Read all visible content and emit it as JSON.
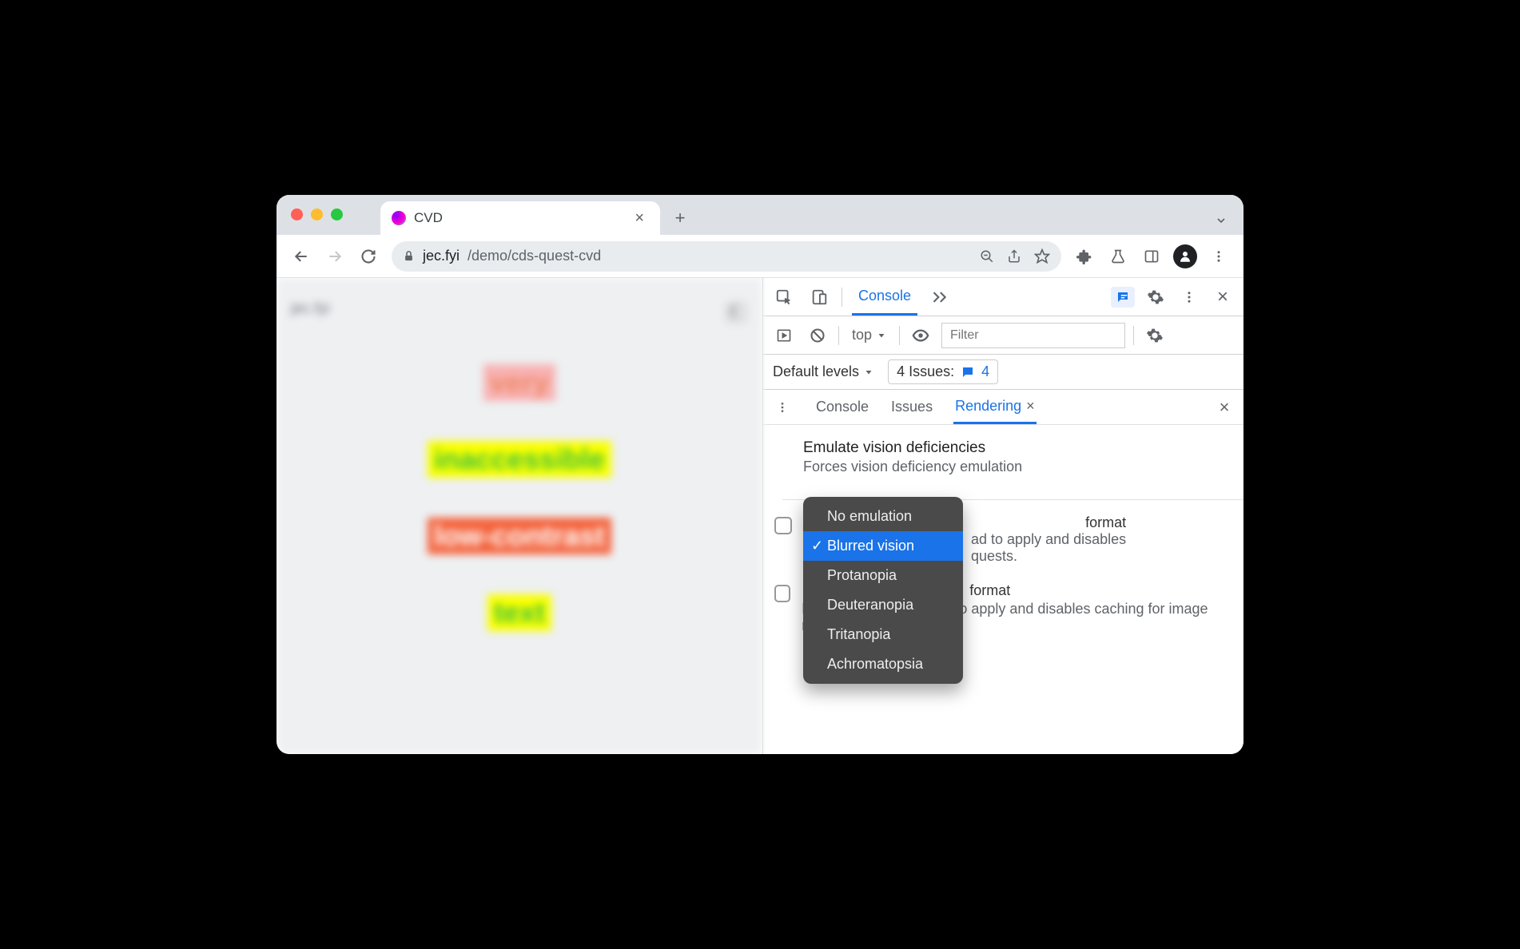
{
  "browser": {
    "tab_title": "CVD",
    "url_host": "jec.fyi",
    "url_path": "/demo/cds-quest-cvd"
  },
  "page": {
    "site_label": "jec.fyi",
    "words": [
      "very",
      "inaccessible",
      "low-contrast",
      "text"
    ]
  },
  "devtools": {
    "main_tab": "Console",
    "context": "top",
    "filter_placeholder": "Filter",
    "levels": "Default levels",
    "issues_label": "4 Issues:",
    "issues_count": "4",
    "drawer": {
      "tabs": [
        "Console",
        "Issues",
        "Rendering"
      ],
      "active": "Rendering"
    },
    "rendering": {
      "section_title": "Emulate vision deficiencies",
      "section_desc": "Forces vision deficiency emulation",
      "dropdown_options": [
        "No emulation",
        "Blurred vision",
        "Protanopia",
        "Deuteranopia",
        "Tritanopia",
        "Achromatopsia"
      ],
      "dropdown_selected": "Blurred vision",
      "item1_title_frag": "format",
      "item1_desc": "ad to apply and disables",
      "item1_desc2": "quests.",
      "item2_title_frag": "format",
      "item2_desc": "Requires a page reload to apply and disables caching for image requests."
    }
  }
}
